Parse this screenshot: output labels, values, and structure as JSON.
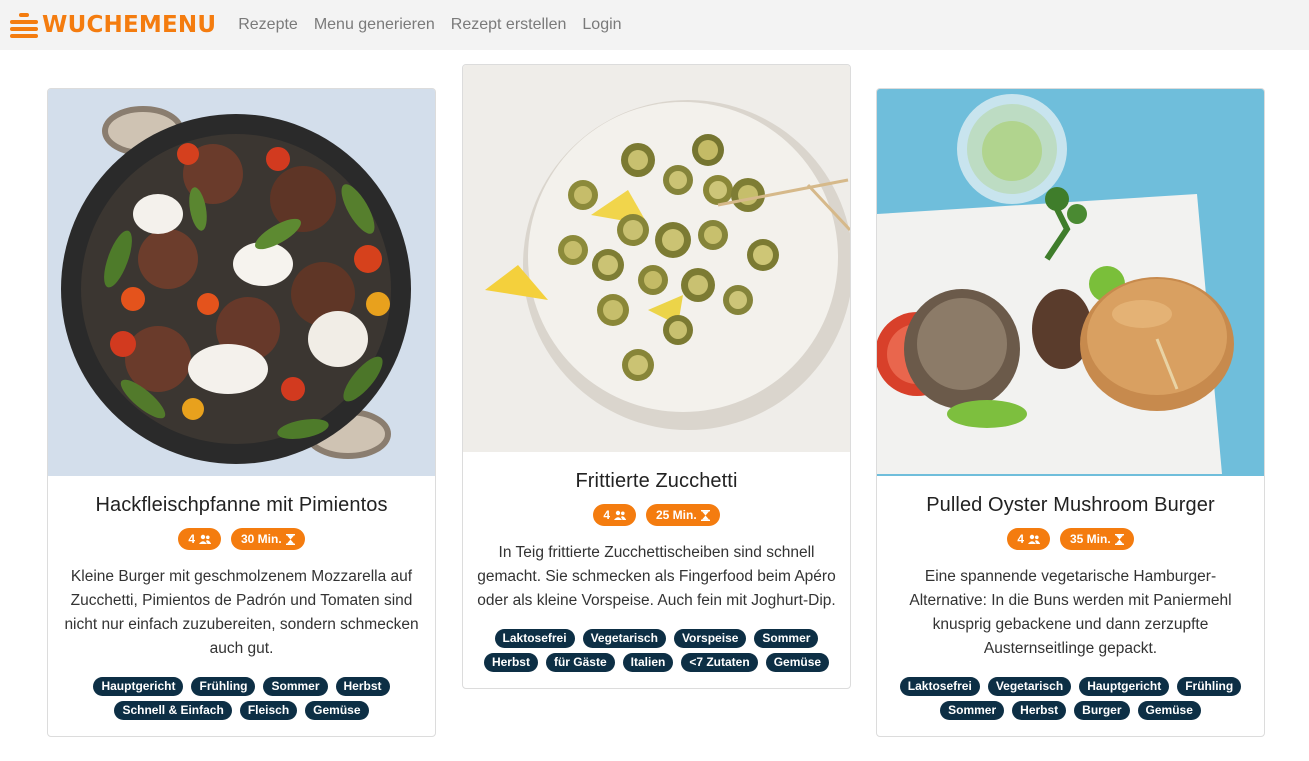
{
  "nav": {
    "brand": "WUCHEMENU",
    "links": [
      "Rezepte",
      "Menu generieren",
      "Rezept erstellen",
      "Login"
    ]
  },
  "colors": {
    "accent": "#f47c0f",
    "tag_bg": "#0d2f45",
    "nav_bg": "#f3f3f3"
  },
  "recipes": [
    {
      "title": "Hackfleischpfanne mit Pimientos",
      "servings": "4",
      "time": "30 Min.",
      "description": "Kleine Burger mit geschmolzenem Mozzarella auf Zucchetti, Pimientos de Padrón und Tomaten sind nicht nur einfach zuzubereiten, sondern schmecken auch gut.",
      "tags": [
        "Hauptgericht",
        "Frühling",
        "Sommer",
        "Herbst",
        "Schnell & Einfach",
        "Fleisch",
        "Gemüse"
      ]
    },
    {
      "title": "Frittierte Zucchetti",
      "servings": "4",
      "time": "25 Min.",
      "description": "In Teig frittierte Zucchettischeiben sind schnell gemacht. Sie schmecken als Fingerfood beim Apéro oder als kleine Vorspeise. Auch fein mit Joghurt-Dip.",
      "tags": [
        "Laktosefrei",
        "Vegetarisch",
        "Vorspeise",
        "Sommer",
        "Herbst",
        "für Gäste",
        "Italien",
        "<7 Zutaten",
        "Gemüse"
      ]
    },
    {
      "title": "Pulled Oyster Mushroom Burger",
      "servings": "4",
      "time": "35 Min.",
      "description": "Eine spannende vegetarische Hamburger-Alternative: In die Buns werden mit Paniermehl knusprig gebackene und dann zerzupfte Austernseitlinge gepackt.",
      "tags": [
        "Laktosefrei",
        "Vegetarisch",
        "Hauptgericht",
        "Frühling",
        "Sommer",
        "Herbst",
        "Burger",
        "Gemüse"
      ]
    }
  ],
  "icons": {
    "servings": "people-icon",
    "time": "hourglass-icon",
    "brand": "menu-lines-icon"
  }
}
